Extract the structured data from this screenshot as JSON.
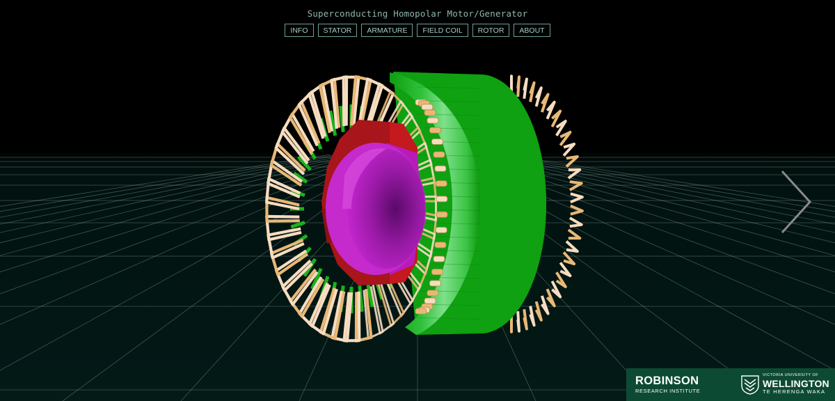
{
  "app": {
    "title": "Superconducting Homopolar Motor/Generator"
  },
  "nav": {
    "items": [
      {
        "id": "info",
        "label": "INFO"
      },
      {
        "id": "stator",
        "label": "STATOR"
      },
      {
        "id": "armature",
        "label": "ARMATURE"
      },
      {
        "id": "field-coil",
        "label": "FIELD COIL"
      },
      {
        "id": "rotor",
        "label": "ROTOR"
      },
      {
        "id": "about",
        "label": "ABOUT"
      }
    ]
  },
  "controls": {
    "next_icon": "chevron-right-icon"
  },
  "logos": {
    "robinson": {
      "name": "ROBINSON",
      "subtitle": "RESEARCH INSTITUTE"
    },
    "vuw": {
      "top": "VICTORIA UNIVERSITY OF",
      "name": "WELLINGTON",
      "bottom": "TE HERENGA WAKA",
      "crest_icon": "university-crest-icon"
    }
  },
  "colors": {
    "background": "#000000",
    "floor": "#031a17",
    "grid": "#a9d4cc",
    "stator": "#10b010",
    "coil_light": "#f6dcc0",
    "coil_warm": "#e9b876",
    "field_coil": "#b5161b",
    "rotor": "#c21ec8",
    "ui_text": "#a9cdc7",
    "logo_bar": "#0d4a34"
  }
}
